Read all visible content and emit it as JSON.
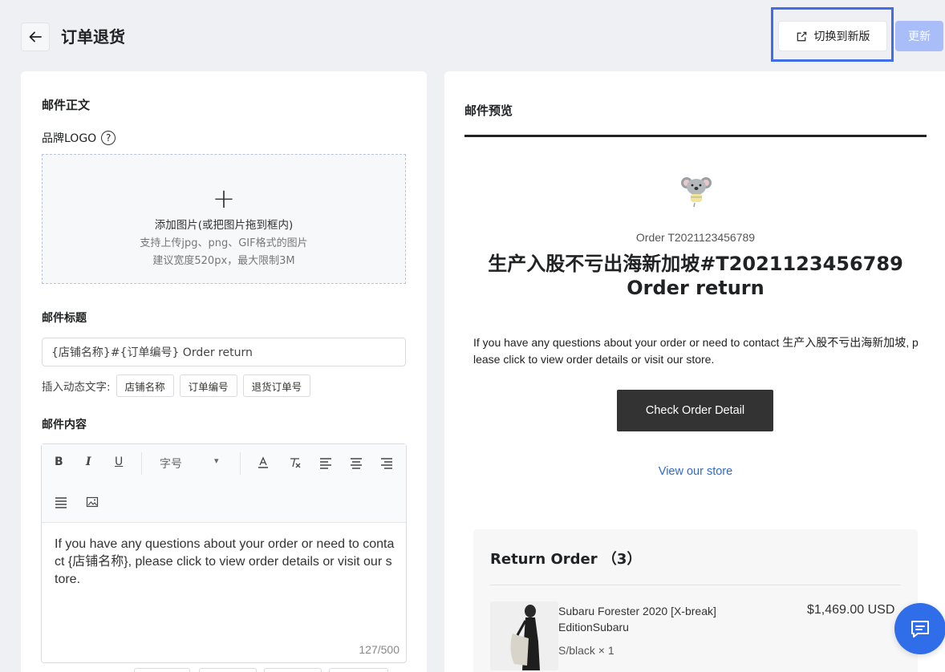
{
  "header": {
    "back_icon": "arrow-left-icon",
    "title": "订单退货",
    "switch_label": "切换到新版",
    "switch_icon": "external-link-icon",
    "update_label": "更新"
  },
  "editor_panel": {
    "body_title": "邮件正文",
    "logo_label": "品牌LOGO",
    "logo_help": "?",
    "upload": {
      "plus": "+",
      "line1": "添加图片(或把图片拖到框内)",
      "line2": "支持上传jpg、png、GIF格式的图片",
      "line3": "建议宽度520px，最大限制3M"
    },
    "subject_label": "邮件标题",
    "subject_value": "{店铺名称}#{订单编号} Order return",
    "insert_label": "插入动态文字:",
    "insert_tags": [
      "店铺名称",
      "订单编号",
      "退货订单号"
    ],
    "content_label": "邮件内容",
    "toolbar": {
      "bold": "B",
      "italic": "I",
      "underline": "U",
      "font_size": "字号",
      "font_size_arrow": "▾"
    },
    "content_text": "If you have any questions about your order or need to contact {店铺名称}, please click to view order details or visit our store.",
    "counter": "127/500"
  },
  "preview_panel": {
    "title": "邮件预览",
    "order_number": "Order T2021123456789",
    "heading_line1": "生产入股不亏出海新加坡#T2021123456789",
    "heading_line2": "Order return",
    "body_text": "If you have any questions about your order or need to contact 生产入股不亏出海新加坡, please click to view order details or visit our store.",
    "check_button": "Check Order Detail",
    "view_store": "View our store",
    "return_order": {
      "title": "Return Order （3）",
      "product_name": "Subaru Forester 2020 [X-break] EditionSubaru",
      "variant": "S/black × 1",
      "price": "$1,469.00 USD"
    }
  },
  "colors": {
    "accent": "#3f6ee8",
    "update_disabled": "#a9bdf8",
    "chat": "#2f6ee8",
    "link": "#2e6ad0"
  }
}
